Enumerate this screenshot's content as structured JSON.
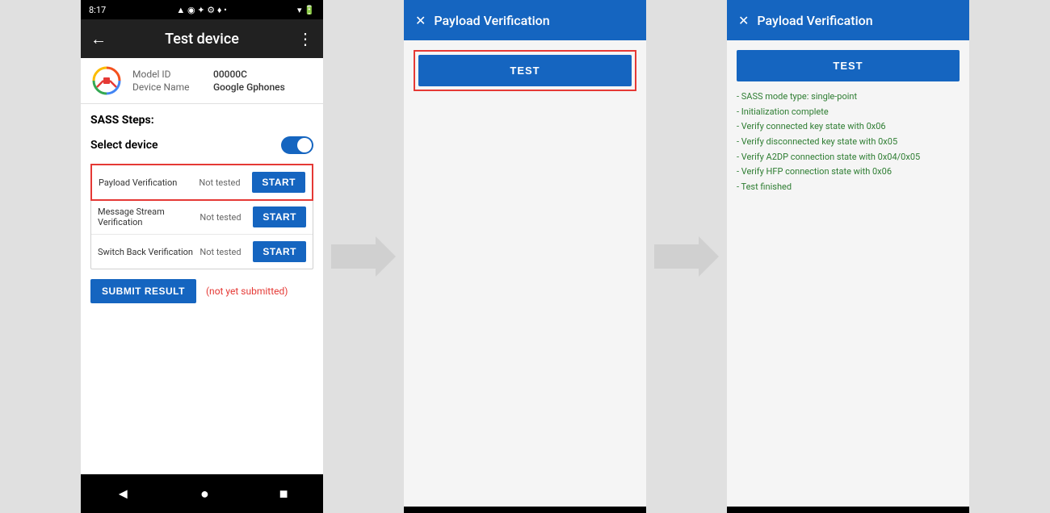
{
  "phone": {
    "status_bar": {
      "time": "8:17",
      "icons": "status icons"
    },
    "header": {
      "back_label": "←",
      "title": "Test device",
      "more_label": "⋮"
    },
    "device": {
      "model_id_label": "Model ID",
      "model_id_value": "00000C",
      "device_name_label": "Device Name",
      "device_name_value": "Google Gphones"
    },
    "sass": {
      "title": "SASS Steps:",
      "select_device_label": "Select device"
    },
    "steps": [
      {
        "name": "Payload Verification",
        "status": "Not tested",
        "btn_label": "START",
        "highlighted": true
      },
      {
        "name": "Message Stream Verification",
        "status": "Not tested",
        "btn_label": "START",
        "highlighted": false
      },
      {
        "name": "Switch Back Verification",
        "status": "Not tested",
        "btn_label": "START",
        "highlighted": false
      }
    ],
    "submit": {
      "btn_label": "SUBMIT RESULT",
      "note": "(not yet submitted)"
    },
    "nav": {
      "back": "◄",
      "home": "●",
      "recents": "■"
    }
  },
  "dialog1": {
    "close_label": "✕",
    "title": "Payload Verification",
    "test_btn_label": "TEST",
    "bottom_bar": ""
  },
  "dialog2": {
    "close_label": "✕",
    "title": "Payload Verification",
    "test_btn_label": "TEST",
    "results": [
      "- SASS mode type: single-point",
      "- Initialization complete",
      "- Verify connected key state with 0x06",
      "- Verify disconnected key state with 0x05",
      "- Verify A2DP connection state with 0x04/0x05",
      "- Verify HFP connection state with 0x06",
      "- Test finished"
    ]
  },
  "arrows": {
    "arrow_label": "→"
  }
}
